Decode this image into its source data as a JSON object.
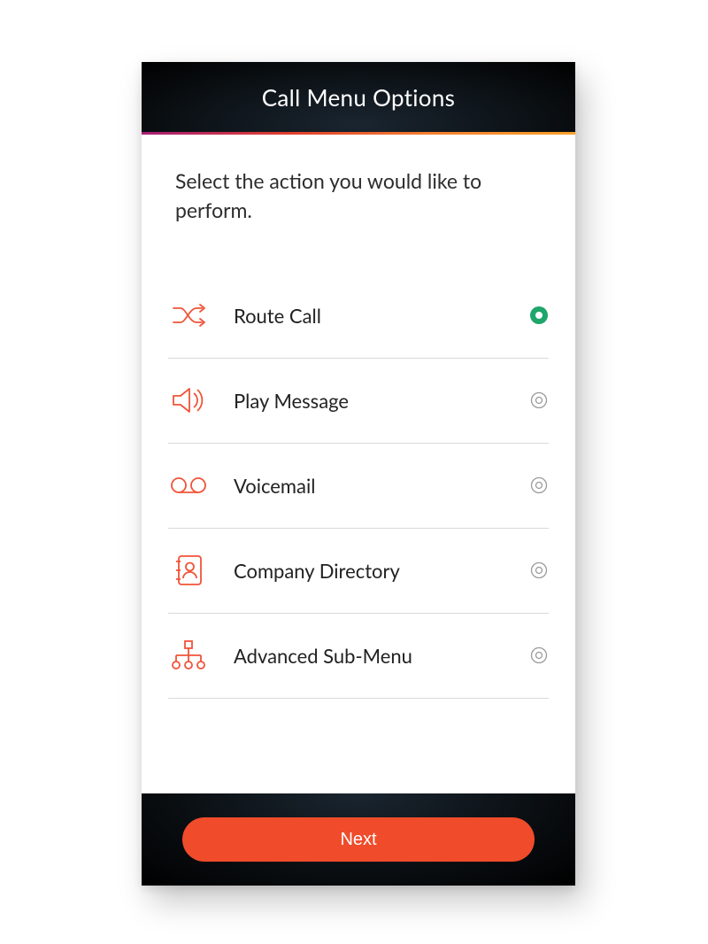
{
  "header": {
    "title": "Call Menu Options"
  },
  "prompt": "Select the action you would like to perform.",
  "options": [
    {
      "id": "route-call",
      "label": "Route Call",
      "icon": "shuffle-icon",
      "selected": true
    },
    {
      "id": "play-message",
      "label": "Play Message",
      "icon": "megaphone-icon",
      "selected": false
    },
    {
      "id": "voicemail",
      "label": "Voicemail",
      "icon": "voicemail-icon",
      "selected": false
    },
    {
      "id": "company-directory",
      "label": "Company Directory",
      "icon": "directory-icon",
      "selected": false
    },
    {
      "id": "advanced-sub-menu",
      "label": "Advanced Sub-Menu",
      "icon": "hierarchy-icon",
      "selected": false
    }
  ],
  "footer": {
    "next_label": "Next"
  },
  "colors": {
    "accent": "#f05438",
    "button": "#f04b2a",
    "selected": "#1fa66a"
  }
}
